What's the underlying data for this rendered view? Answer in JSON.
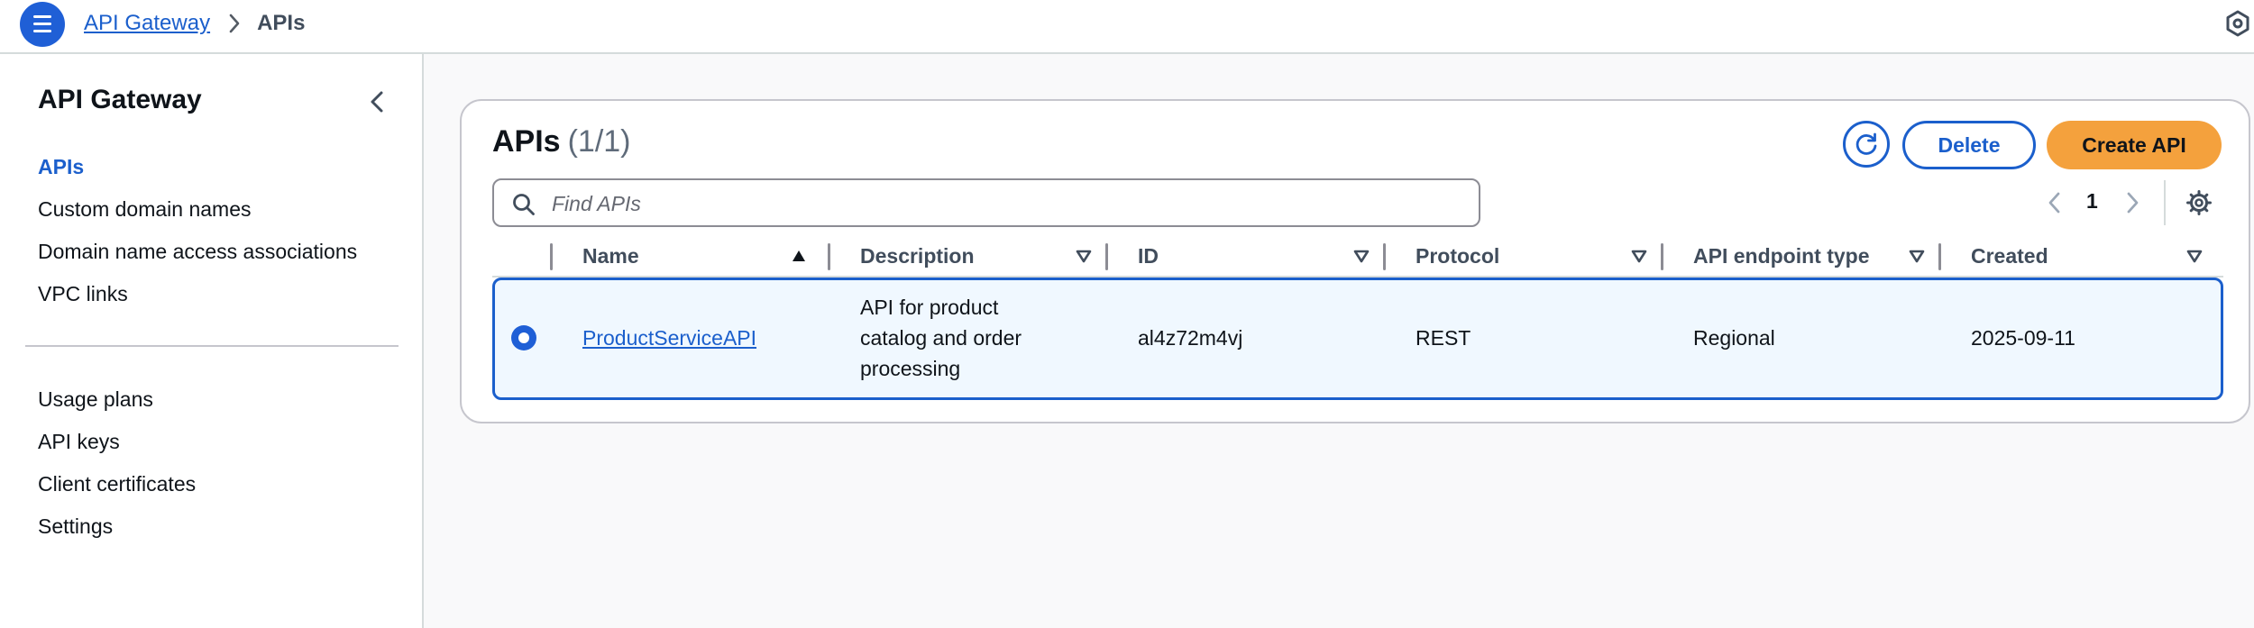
{
  "header": {
    "breadcrumb": [
      {
        "label": "API Gateway"
      },
      {
        "label": "APIs"
      }
    ]
  },
  "sidebar": {
    "title": "API Gateway",
    "items": [
      {
        "label": "APIs",
        "active": true
      },
      {
        "label": "Custom domain names"
      },
      {
        "label": "Domain name access associations"
      },
      {
        "label": "VPC links"
      },
      {
        "label": "Usage plans"
      },
      {
        "label": "API keys"
      },
      {
        "label": "Client certificates"
      },
      {
        "label": "Settings"
      }
    ]
  },
  "main": {
    "title": "APIs",
    "count": "(1/1)",
    "actions": {
      "delete_label": "Delete",
      "create_label": "Create API"
    },
    "search": {
      "placeholder": "Find APIs",
      "value": ""
    },
    "pagination": {
      "current_page": "1"
    },
    "table": {
      "columns": [
        "Name",
        "Description",
        "ID",
        "Protocol",
        "API endpoint type",
        "Created"
      ],
      "sort": {
        "column": "Name",
        "direction": "ascending"
      },
      "rows": [
        {
          "selected": true,
          "name": "ProductServiceAPI",
          "description_lines": [
            "API for product",
            "catalog and order",
            "processing"
          ],
          "id": "al4z72m4vj",
          "protocol": "REST",
          "endpoint_type": "Regional",
          "created": "2025-09-11"
        }
      ]
    }
  },
  "colors": {
    "accent": "#1b5fcc",
    "primary_button": "#f4a13d",
    "selected_row_bg": "#f0f8ff"
  },
  "icons": [
    "menu-icon",
    "chevron-right-icon",
    "hexagon-icon",
    "chevron-left-icon",
    "refresh-icon",
    "search-icon",
    "gear-icon",
    "sort-ascending-icon",
    "sort-descending-icon"
  ]
}
